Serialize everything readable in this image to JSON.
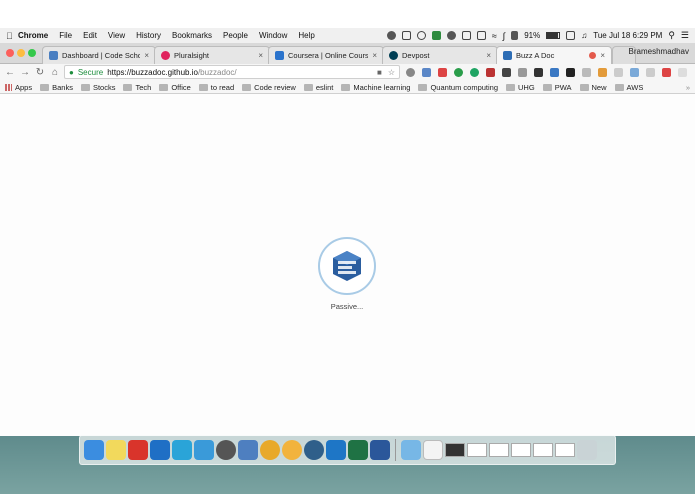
{
  "menubar": {
    "app_name": "Chrome",
    "items": [
      "File",
      "Edit",
      "View",
      "History",
      "Bookmarks",
      "People",
      "Window",
      "Help"
    ],
    "battery": "91%",
    "clock": "Tue Jul 18  6:29 PM"
  },
  "tabs": [
    {
      "title": "Dashboard | Code School",
      "icon": "code-school-icon",
      "color": "#4a7fc1"
    },
    {
      "title": "Pluralsight",
      "icon": "pluralsight-icon",
      "color": "#e0245e"
    },
    {
      "title": "Coursera | Online Courses",
      "icon": "coursera-icon",
      "color": "#2a73cc"
    },
    {
      "title": "Devpost",
      "icon": "devpost-icon",
      "color": "#003e54"
    },
    {
      "title": "Buzz A Doc",
      "icon": "buzz-a-doc-icon",
      "color": "#2d6db5",
      "active": true
    }
  ],
  "profile_name": "Brameshmadhav",
  "address": {
    "security_label": "Secure",
    "url_host": "https://buzzadoc.github.io",
    "url_path": "/buzzadoc/"
  },
  "bookmarks": [
    "Apps",
    "Banks",
    "Stocks",
    "Tech",
    "Office",
    "to read",
    "Code review",
    "eslint",
    "Machine learning",
    "Quantum computing",
    "UHG",
    "PWA",
    "New",
    "AWS"
  ],
  "page": {
    "status_text": "Passive...",
    "logo_color": "#2a5d9f",
    "ring_color": "#a9cbe6"
  }
}
